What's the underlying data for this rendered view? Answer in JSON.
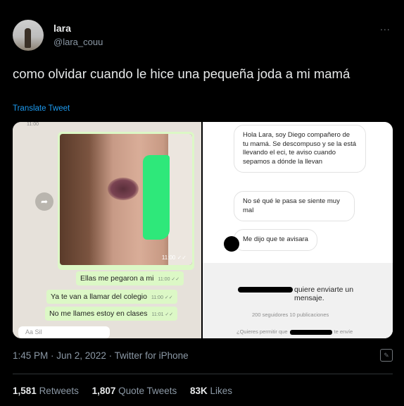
{
  "tweet": {
    "name": "lara",
    "handle": "@lara_couu",
    "more": "...",
    "text": "como olvidar cuando le hice una pequeña joda a mi mamá",
    "translate": "Translate Tweet",
    "timestamp": "1:45 PM · Jun 2, 2022 · Twitter for iPhone"
  },
  "stats": {
    "retweets_value": "1,581",
    "retweets_label": "Retweets",
    "quotes_value": "1,807",
    "quotes_label": "Quote Tweets",
    "likes_value": "83K",
    "likes_label": "Likes"
  },
  "media": {
    "whatsapp": {
      "top_time": "11:00",
      "photo_time": "11:00",
      "messages": [
        {
          "text": "Ellas me pegaron a mi",
          "time": "11:00"
        },
        {
          "text": "Ya te van a llamar del colegio",
          "time": "11:00"
        },
        {
          "text": "No me llames estoy en clases",
          "time": "11:01"
        }
      ],
      "input_placeholder": "Aa Sil"
    },
    "instagram": {
      "messages": [
        "Hola Lara, soy Diego compañero de tu mamá. Se descompuso y se la está llevando el eci, te aviso cuando sepamos a dónde la llevan",
        "No sé qué le pasa se siente muy mal",
        "Me dijo que te avisara"
      ],
      "wants_text": "quiere enviarte un mensaje.",
      "account_stats": "200 seguidores 10 publicaciones",
      "permit_text": "¿Quieres permitir que",
      "permit_tail": "te envíe"
    }
  },
  "colors": {
    "background": "#000000",
    "text": "#e7e9ea",
    "muted": "#8b98a5",
    "link": "#1d9bf0",
    "whatsapp_bubble": "#dcf8c6"
  },
  "icons": [
    "more-icon",
    "share-icon",
    "compose-icon",
    "read-check-icon"
  ]
}
